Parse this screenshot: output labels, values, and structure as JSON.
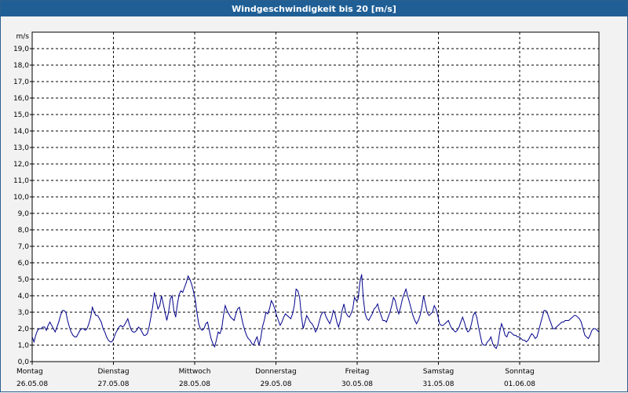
{
  "window": {
    "title": "Windgeschwindigkeit bis 20 [m/s]"
  },
  "colors": {
    "titlebar": "#1f5f96",
    "series": "#00008b",
    "grid": "#000000",
    "plot_bg": "#ffffff"
  },
  "chart_data": {
    "type": "line",
    "title": "Windgeschwindigkeit bis 20 [m/s]",
    "ylabel": "m/s",
    "xlabel": "",
    "ylim": [
      0,
      19
    ],
    "xlim": [
      0,
      7
    ],
    "y_ticks": [
      "0,0",
      "1,0",
      "2,0",
      "3,0",
      "4,0",
      "5,0",
      "6,0",
      "7,0",
      "8,0",
      "9,0",
      "10,0",
      "11,0",
      "12,0",
      "13,0",
      "14,0",
      "15,0",
      "16,0",
      "17,0",
      "18,0",
      "19,0"
    ],
    "x_ticks": [
      {
        "day": "Montag",
        "date": "26.05.08"
      },
      {
        "day": "Dienstag",
        "date": "27.05.08"
      },
      {
        "day": "Mittwoch",
        "date": "28.05.08"
      },
      {
        "day": "Donnerstag",
        "date": "29.05.08"
      },
      {
        "day": "Freitag",
        "date": "30.05.08"
      },
      {
        "day": "Samstag",
        "date": "31.05.08"
      },
      {
        "day": "Sonntag",
        "date": "01.06.08"
      }
    ],
    "grid": true,
    "series": [
      {
        "values": [
          1.5,
          1.2,
          1.6,
          1.9,
          2.0,
          2.0,
          2.1,
          2.1,
          1.9,
          2.2,
          2.4,
          2.2,
          2.0,
          1.8,
          2.1,
          2.4,
          2.8,
          3.1,
          3.1,
          3.0,
          2.5,
          2.1,
          1.8,
          1.6,
          1.5,
          1.5,
          1.7,
          1.9,
          2.0,
          2.0,
          1.9,
          2.0,
          2.3,
          2.7,
          3.3,
          3.0,
          2.8,
          2.8,
          2.6,
          2.4,
          2.0,
          1.8,
          1.5,
          1.3,
          1.2,
          1.2,
          1.4,
          1.7,
          1.9,
          2.1,
          2.2,
          2.1,
          2.2,
          2.4,
          2.6,
          2.2,
          1.9,
          1.8,
          1.8,
          1.9,
          2.1,
          2.0,
          1.8,
          1.6,
          1.6,
          1.7,
          2.1,
          2.7,
          3.3,
          4.2,
          3.7,
          3.2,
          3.4,
          4.0,
          3.5,
          3.0,
          2.5,
          3.0,
          3.8,
          4.0,
          3.1,
          2.7,
          3.5,
          4.1,
          4.3,
          4.2,
          4.5,
          4.8,
          5.2,
          5.0,
          4.7,
          4.3,
          3.8,
          3.0,
          2.3,
          2.0,
          1.9,
          2.0,
          2.3,
          2.4,
          1.9,
          1.4,
          1.1,
          0.9,
          1.3,
          1.8,
          1.7,
          2.0,
          2.8,
          3.4,
          3.1,
          2.9,
          2.7,
          2.6,
          2.5,
          2.9,
          3.2,
          3.3,
          2.8,
          2.3,
          1.9,
          1.6,
          1.4,
          1.3,
          1.1,
          1.0,
          1.3,
          1.5,
          1.0,
          1.4,
          2.1,
          2.5,
          3.0,
          2.9,
          3.2,
          3.7,
          3.5,
          3.2,
          2.8,
          2.5,
          2.2,
          2.4,
          2.7,
          2.9,
          2.8,
          2.7,
          2.6,
          2.9,
          3.4,
          4.4,
          4.3,
          3.9,
          2.8,
          2.0,
          2.4,
          2.8,
          2.6,
          2.4,
          2.3,
          2.1,
          1.8,
          2.0,
          2.4,
          2.8,
          3.0,
          3.0,
          2.7,
          2.5,
          2.3,
          2.6,
          3.1,
          2.9,
          2.4,
          2.1,
          2.5,
          3.1,
          3.5,
          3.0,
          2.8,
          2.7,
          2.9,
          3.2,
          3.9,
          3.7,
          3.8,
          4.8,
          5.3,
          3.8,
          2.9,
          2.6,
          2.5,
          2.7,
          2.9,
          3.2,
          3.3,
          3.5,
          3.1,
          2.8,
          2.5,
          2.5,
          2.4,
          2.7,
          3.0,
          3.4,
          3.9,
          3.7,
          3.2,
          2.9,
          3.3,
          3.8,
          4.1,
          4.4,
          4.0,
          3.6,
          3.2,
          2.8,
          2.5,
          2.3,
          2.5,
          2.8,
          3.3,
          4.0,
          3.5,
          3.0,
          2.8,
          2.9,
          3.0,
          3.4,
          3.2,
          2.8,
          2.3,
          2.2,
          2.2,
          2.3,
          2.4,
          2.5,
          2.2,
          2.0,
          1.9,
          1.8,
          1.9,
          2.1,
          2.4,
          2.7,
          2.4,
          2.0,
          1.8,
          1.9,
          2.3,
          2.8,
          3.0,
          2.7,
          2.1,
          1.6,
          1.1,
          1.0,
          1.0,
          1.2,
          1.3,
          1.5,
          1.1,
          0.9,
          0.8,
          1.1,
          1.8,
          2.3,
          2.0,
          1.6,
          1.5,
          1.8,
          1.8,
          1.7,
          1.6,
          1.6,
          1.5,
          1.5,
          1.4,
          1.3,
          1.3,
          1.2,
          1.3,
          1.5,
          1.7,
          1.6,
          1.4,
          1.5,
          1.9,
          2.3,
          2.7,
          3.1,
          3.1,
          2.9,
          2.6,
          2.3,
          2.0,
          2.0,
          2.1,
          2.2,
          2.3,
          2.4,
          2.4,
          2.5,
          2.5,
          2.5,
          2.6,
          2.7,
          2.8,
          2.8,
          2.7,
          2.6,
          2.4,
          2.0,
          1.6,
          1.5,
          1.4,
          1.6,
          1.9,
          2.0,
          2.0,
          1.9,
          1.8
        ]
      }
    ]
  }
}
